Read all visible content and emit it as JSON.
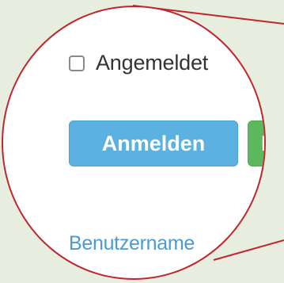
{
  "login_form": {
    "remember_label": "Angemeldet",
    "login_label": "Anmelden",
    "register_label": "R",
    "username_link": "Benutzername"
  },
  "colors": {
    "background": "#e8eedf",
    "callout_border": "#c0272d",
    "login_button": "#5bb1e0",
    "register_button": "#5cb85c",
    "link": "#4a9bd1"
  }
}
